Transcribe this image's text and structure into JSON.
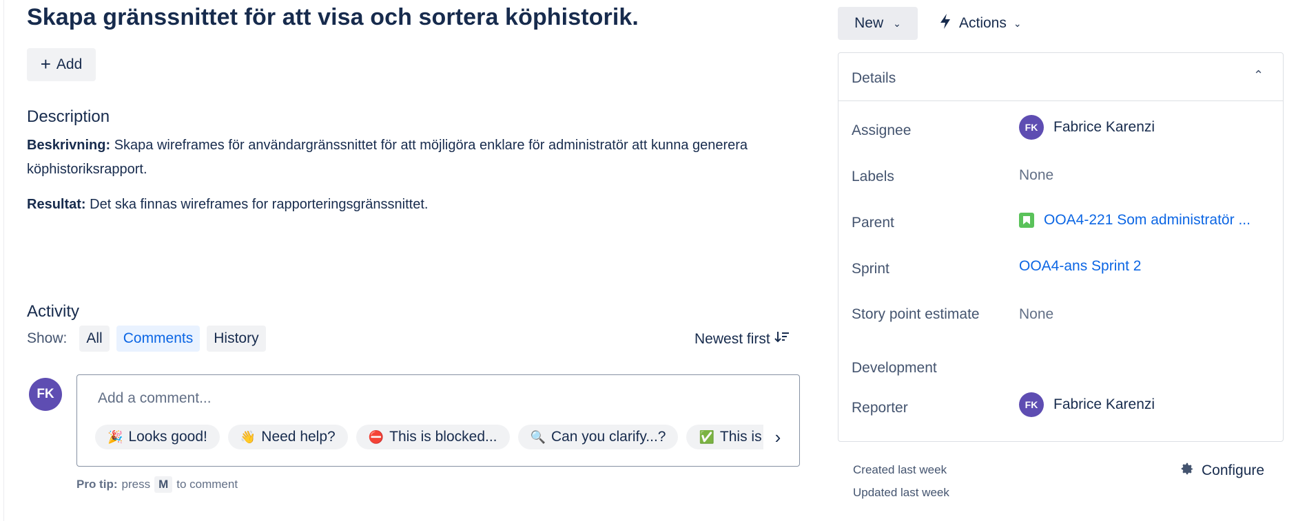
{
  "issue": {
    "title": "Skapa gränssnittet för att visa och sortera köphistorik.",
    "add_label": "Add"
  },
  "description": {
    "heading": "Description",
    "p1_label": "Beskrivning:",
    "p1_text": " Skapa wireframes för användargränssnittet för att möjligöra enklare för administratör att kunna generera köphistoriksrapport.",
    "p2_label": "Resultat:",
    "p2_text": " Det ska finnas wireframes for rapporteringsgränssnittet."
  },
  "activity": {
    "heading": "Activity",
    "show_label": "Show:",
    "filters": [
      "All",
      "Comments",
      "History"
    ],
    "active_filter": "Comments",
    "sort_label": "Newest first",
    "comment_avatar": "FK",
    "comment_placeholder": "Add a comment...",
    "chips": [
      {
        "emoji": "🎉",
        "label": "Looks good!"
      },
      {
        "emoji": "👋",
        "label": "Need help?"
      },
      {
        "emoji": "⛔",
        "label": "This is blocked..."
      },
      {
        "emoji": "🔍",
        "label": "Can you clarify...?"
      },
      {
        "emoji": "✅",
        "label": "This is on track"
      }
    ],
    "protip_label": "Pro tip:",
    "protip_press": "press",
    "protip_key": "M",
    "protip_suffix": "to comment"
  },
  "toolbar": {
    "status_label": "New",
    "actions_label": "Actions"
  },
  "details": {
    "title": "Details",
    "fields": {
      "assignee": {
        "label": "Assignee",
        "avatar": "FK",
        "value": "Fabrice Karenzi"
      },
      "labels": {
        "label": "Labels",
        "value": "None"
      },
      "parent": {
        "label": "Parent",
        "value": "OOA4-221 Som administratör ..."
      },
      "sprint": {
        "label": "Sprint",
        "value": "OOA4-ans Sprint 2"
      },
      "story_points": {
        "label": "Story point estimate",
        "value": "None"
      },
      "development": {
        "label": "Development"
      },
      "reporter": {
        "label": "Reporter",
        "avatar": "FK",
        "value": "Fabrice Karenzi"
      }
    }
  },
  "meta": {
    "created": "Created last week",
    "updated": "Updated last week",
    "configure_label": "Configure"
  },
  "colors": {
    "link": "#0c66e4",
    "avatar": "#5e4db2",
    "story": "#5ac25a"
  }
}
